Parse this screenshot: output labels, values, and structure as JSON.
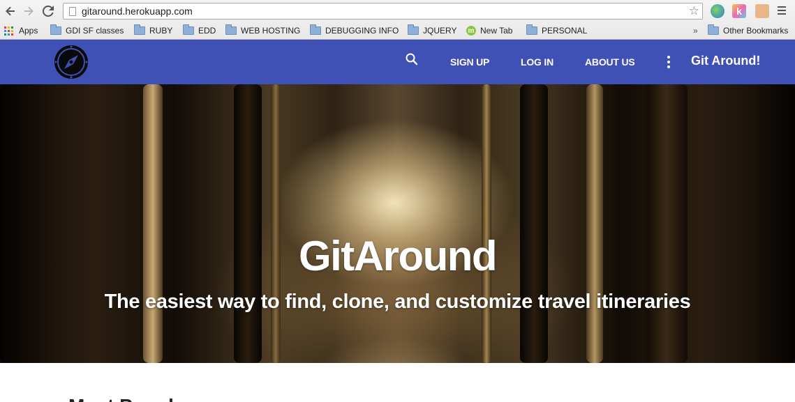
{
  "browser": {
    "url": "gitaround.herokuapp.com",
    "bookmarks": [
      {
        "label": "Apps",
        "icon": "apps-grid-icon"
      },
      {
        "label": "GDI SF classes",
        "icon": "folder-icon"
      },
      {
        "label": "RUBY",
        "icon": "folder-icon"
      },
      {
        "label": "EDD",
        "icon": "folder-icon"
      },
      {
        "label": "WEB HOSTING",
        "icon": "folder-icon"
      },
      {
        "label": "DEBUGGING INFO",
        "icon": "folder-icon"
      },
      {
        "label": "JQUERY",
        "icon": "folder-icon"
      },
      {
        "label": "New Tab",
        "icon": "m-icon"
      },
      {
        "label": "PERSONAL",
        "icon": "folder-icon"
      }
    ],
    "overflow_label": "»",
    "other_bookmarks": "Other Bookmarks"
  },
  "header": {
    "nav": {
      "signup": "SIGN UP",
      "login": "LOG IN",
      "about": "ABOUT US"
    },
    "brand": "Git Around!",
    "color": "#3f51b5"
  },
  "hero": {
    "title": "GitAround",
    "subtitle": "The easiest way to find, clone, and customize travel itineraries"
  },
  "main": {
    "section_heading": "Most Popular"
  }
}
